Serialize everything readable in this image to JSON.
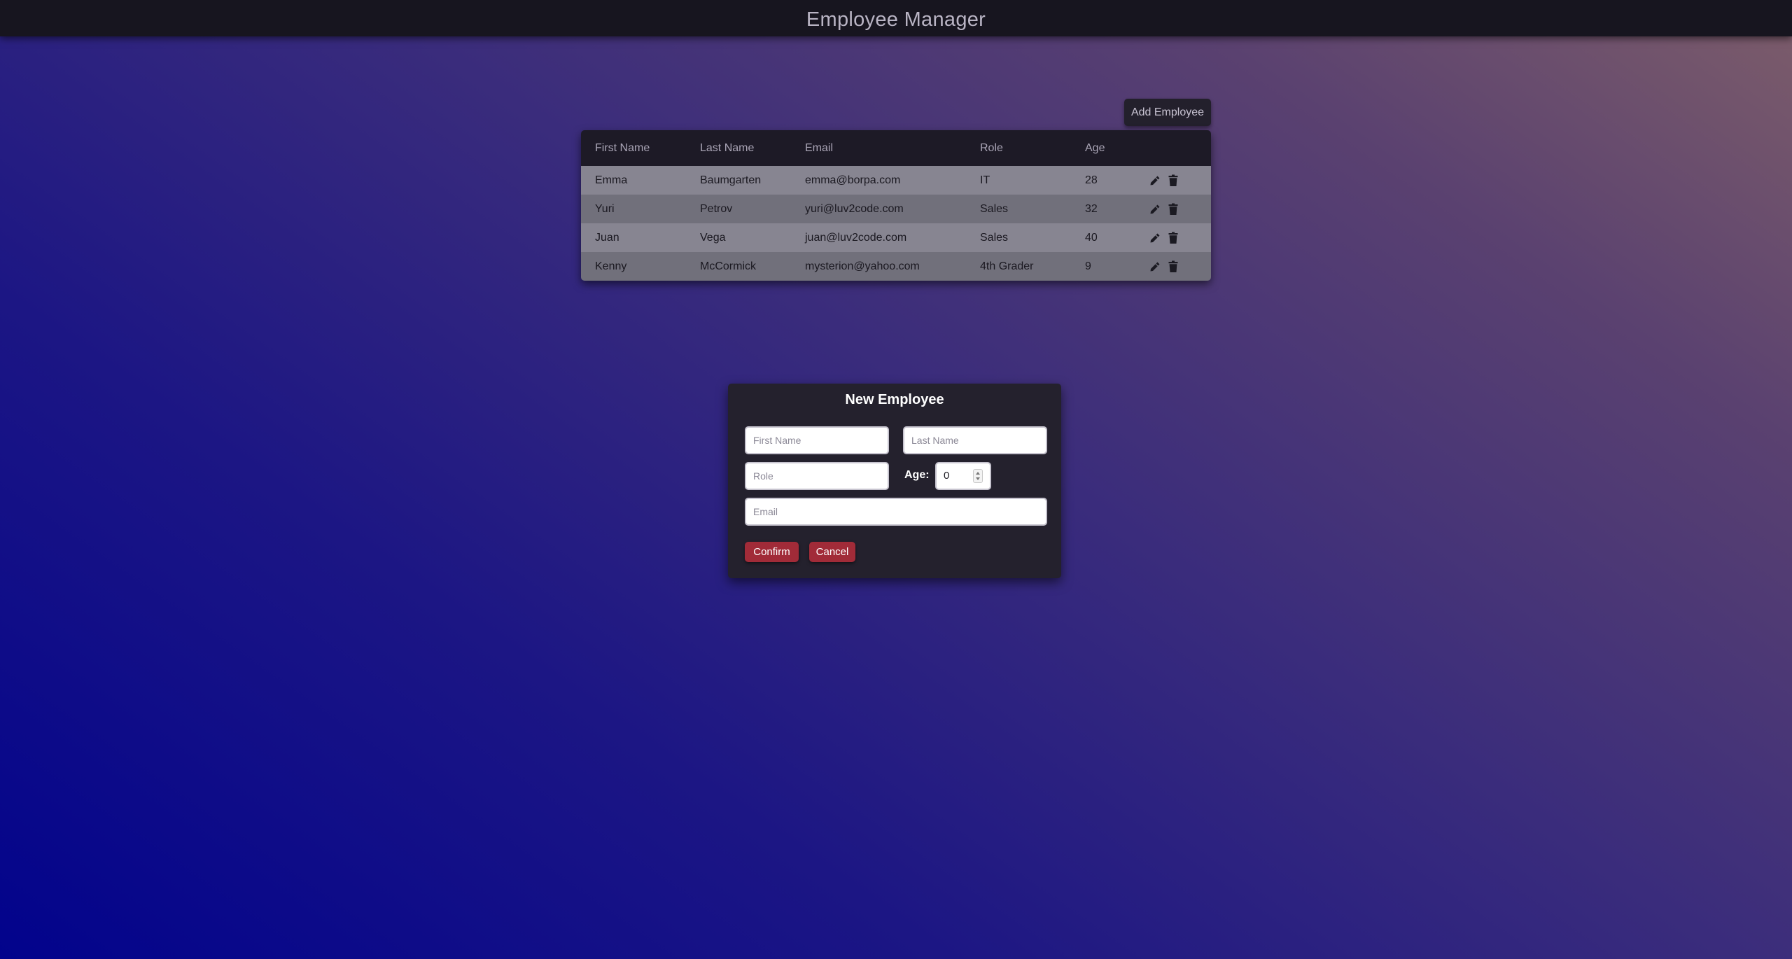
{
  "header": {
    "title": "Employee Manager"
  },
  "toolbar": {
    "add_label": "Add Employee"
  },
  "table": {
    "columns": [
      "First Name",
      "Last Name",
      "Email",
      "Role",
      "Age"
    ],
    "rows": [
      {
        "first": "Emma",
        "last": "Baumgarten",
        "email": "emma@borpa.com",
        "role": "IT",
        "age": "28"
      },
      {
        "first": "Yuri",
        "last": "Petrov",
        "email": "yuri@luv2code.com",
        "role": "Sales",
        "age": "32"
      },
      {
        "first": "Juan",
        "last": "Vega",
        "email": "juan@luv2code.com",
        "role": "Sales",
        "age": "40"
      },
      {
        "first": "Kenny",
        "last": "McCormick",
        "email": "mysterion@yahoo.com",
        "role": "4th Grader",
        "age": "9"
      }
    ],
    "row_icons": [
      "pencil-icon",
      "trash-icon"
    ]
  },
  "modal": {
    "title": "New Employee",
    "first_name_placeholder": "First Name",
    "last_name_placeholder": "Last Name",
    "role_placeholder": "Role",
    "age_label": "Age:",
    "age_value": "0",
    "email_placeholder": "Email",
    "confirm_label": "Confirm",
    "cancel_label": "Cancel"
  },
  "colors": {
    "topbar": "#17151f",
    "card": "#24212d",
    "row_odd": "#878591",
    "row_even": "#71707b",
    "accent_button": "#a12b38"
  }
}
